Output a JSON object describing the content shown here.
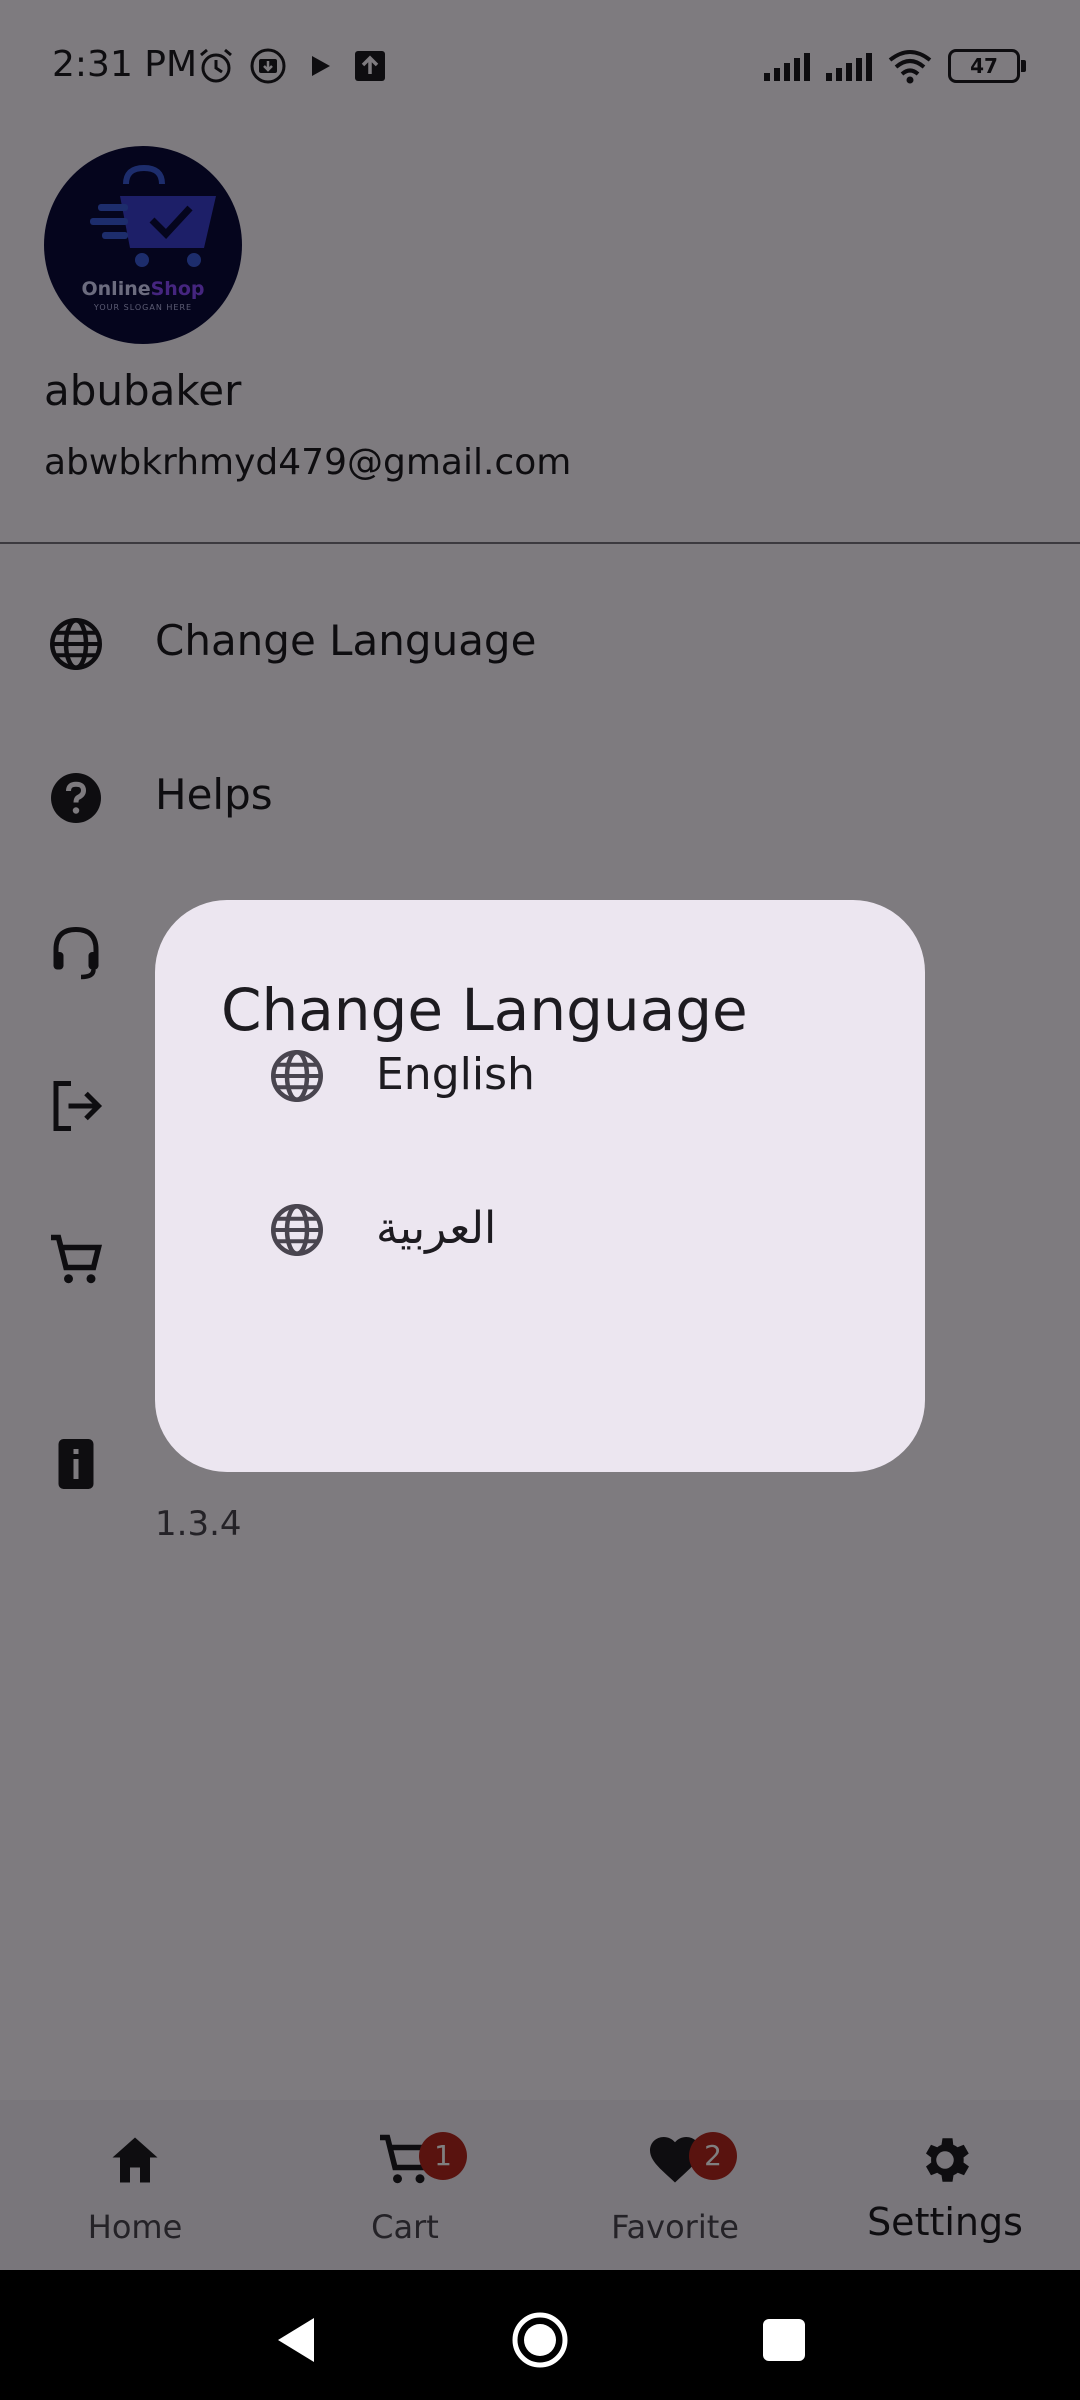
{
  "status_bar": {
    "time": "2:31 PM",
    "battery": "47"
  },
  "profile": {
    "avatar_brand_part1": "Online",
    "avatar_brand_part2": "Shop",
    "avatar_slogan": "YOUR SLOGAN HERE",
    "name": "abubaker",
    "email": "abwbkrhmyd479@gmail.com"
  },
  "menu": {
    "items": [
      {
        "label": "Change Language",
        "icon": "globe-icon"
      },
      {
        "label": "Helps",
        "icon": "help-circle-icon"
      },
      {
        "label": "",
        "icon": "headset-support-icon"
      },
      {
        "label": "",
        "icon": "logout-icon"
      },
      {
        "label": "",
        "icon": "cart-icon"
      },
      {
        "label": "",
        "sub": "1.3.4",
        "icon": "app-info-icon"
      }
    ]
  },
  "dialog": {
    "title": "Change Language",
    "options": [
      {
        "label": "English",
        "icon": "globe-icon"
      },
      {
        "label": "العربية",
        "icon": "globe-icon"
      }
    ]
  },
  "bottom_nav": {
    "items": [
      {
        "label": "Home",
        "icon": "home-icon"
      },
      {
        "label": "Cart",
        "icon": "cart-icon",
        "badge": "1"
      },
      {
        "label": "Favorite",
        "icon": "heart-icon",
        "badge": "2"
      },
      {
        "label": "Settings",
        "icon": "gear-icon",
        "active": true
      }
    ]
  },
  "colors": {
    "dialog_bg": "#ece6f0",
    "scrim": "rgba(0,0,0,0.5)",
    "badge": "#b3261e"
  }
}
